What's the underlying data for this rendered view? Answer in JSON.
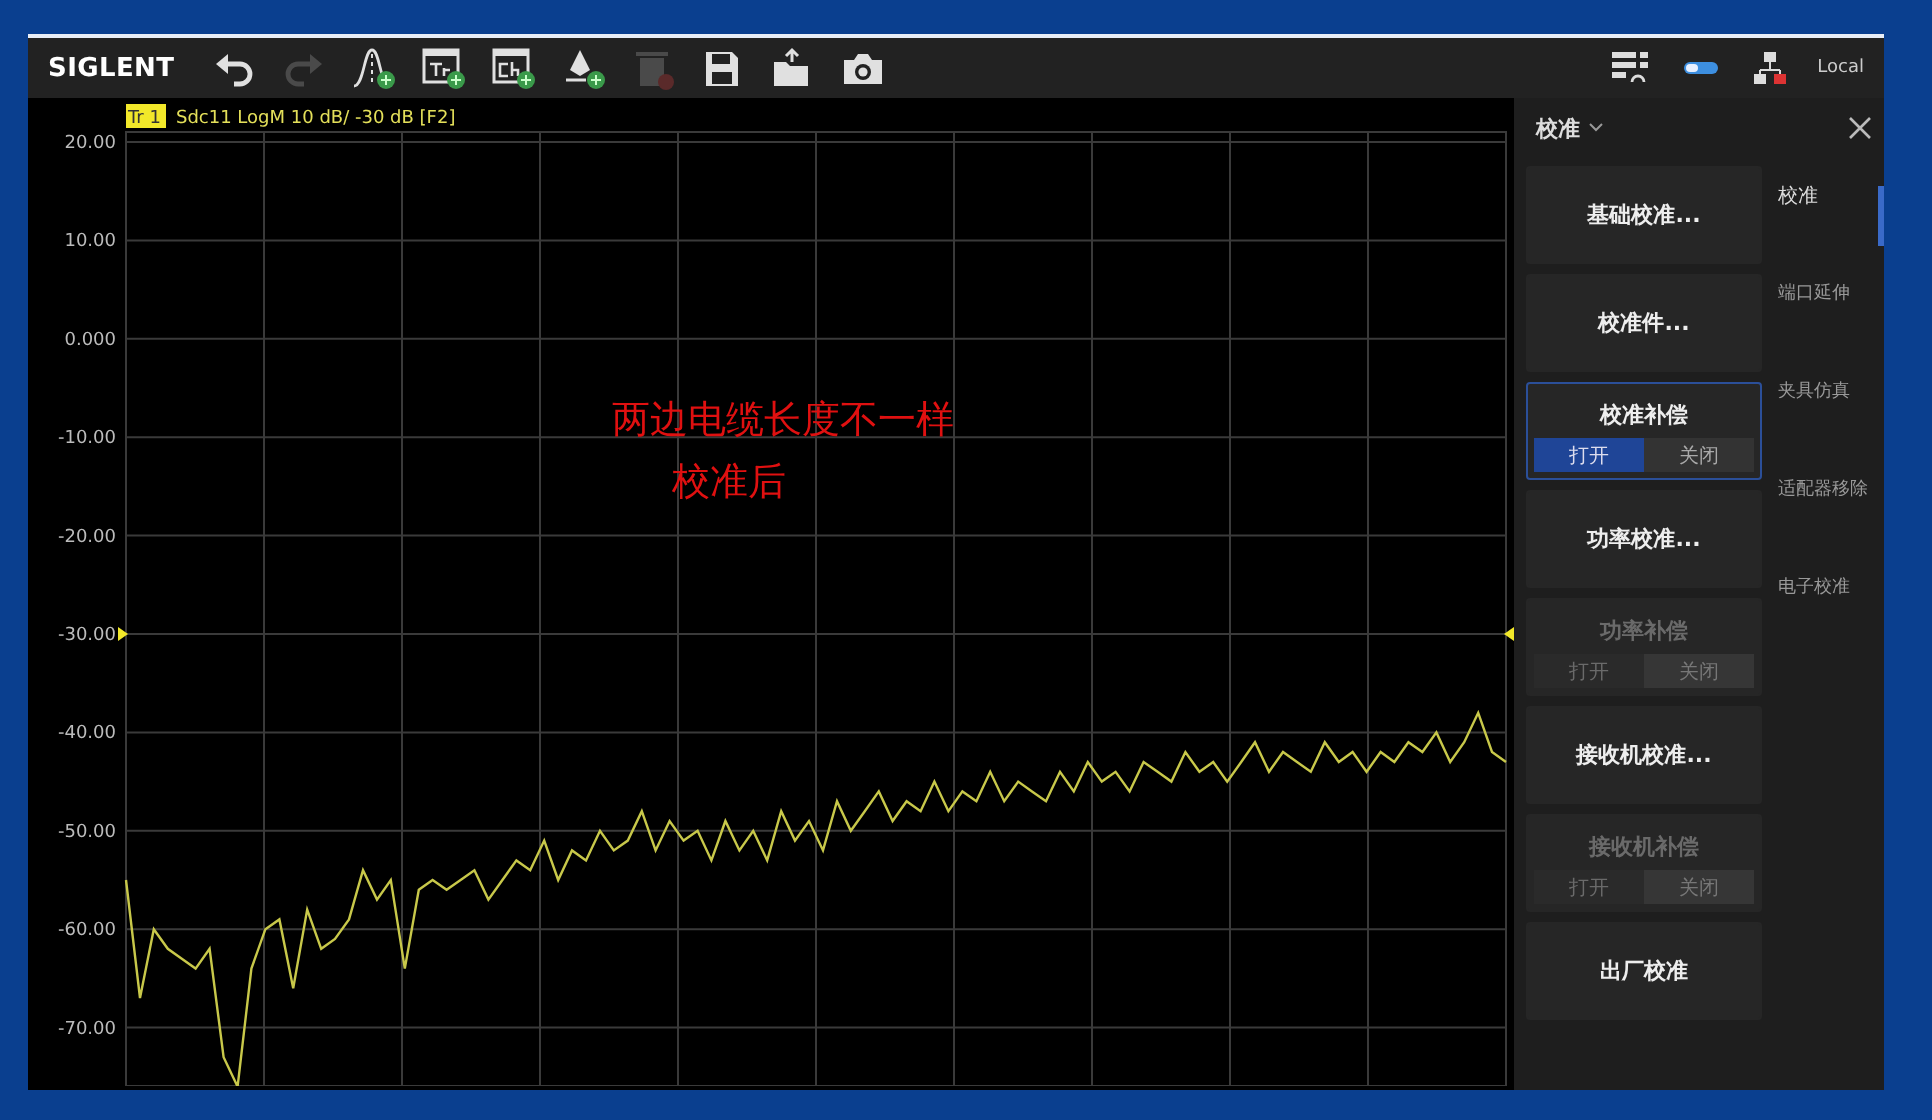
{
  "toolbar": {
    "logo": "SIGLENT",
    "tools": [
      {
        "kind": "undo",
        "disabled": false
      },
      {
        "kind": "redo",
        "disabled": true
      },
      {
        "kind": "trace-add",
        "disabled": false
      },
      {
        "kind": "tr-window-add",
        "disabled": false
      },
      {
        "kind": "ch-window-add",
        "disabled": false
      },
      {
        "kind": "marker-add",
        "disabled": false
      },
      {
        "kind": "delete",
        "disabled": true
      },
      {
        "kind": "save",
        "disabled": false
      },
      {
        "kind": "open",
        "disabled": false
      },
      {
        "kind": "camera",
        "disabled": false
      }
    ],
    "status": {
      "mode": "Local"
    }
  },
  "plot": {
    "trace_badge": "Tr 1",
    "trace_label": "Sdc11 LogM 10 dB/ -30 dB [F2]",
    "reference_markers": {
      "shown": true
    },
    "overlay_note": [
      "两边电缆长度不一样",
      "校准后"
    ],
    "chart_data": {
      "type": "line",
      "ylim": [
        -76,
        21
      ],
      "yticks": [
        {
          "value": 20,
          "label": "20.00"
        },
        {
          "value": 10,
          "label": "10.00"
        },
        {
          "value": 0,
          "label": "0.000"
        },
        {
          "value": -10,
          "label": "-10.00"
        },
        {
          "value": -20,
          "label": "-20.00"
        },
        {
          "value": -30,
          "label": "-30.00"
        },
        {
          "value": -40,
          "label": "-40.00"
        },
        {
          "value": -50,
          "label": "-50.00"
        },
        {
          "value": -60,
          "label": "-60.00"
        },
        {
          "value": -70,
          "label": "-70.00"
        }
      ],
      "grid": true,
      "series": [
        {
          "color": "#c8c84a",
          "values": [
            -55,
            -67,
            -60,
            -62,
            -63,
            -64,
            -62,
            -73,
            -76,
            -64,
            -60,
            -59,
            -66,
            -58,
            -62,
            -61,
            -59,
            -54,
            -57,
            -55,
            -64,
            -56,
            -55,
            -56,
            -55,
            -54,
            -57,
            -55,
            -53,
            -54,
            -51,
            -55,
            -52,
            -53,
            -50,
            -52,
            -51,
            -48,
            -52,
            -49,
            -51,
            -50,
            -53,
            -49,
            -52,
            -50,
            -53,
            -48,
            -51,
            -49,
            -52,
            -47,
            -50,
            -48,
            -46,
            -49,
            -47,
            -48,
            -45,
            -48,
            -46,
            -47,
            -44,
            -47,
            -45,
            -46,
            -47,
            -44,
            -46,
            -43,
            -45,
            -44,
            -46,
            -43,
            -44,
            -45,
            -42,
            -44,
            -43,
            -45,
            -43,
            -41,
            -44,
            -42,
            -43,
            -44,
            -41,
            -43,
            -42,
            -44,
            -42,
            -43,
            -41,
            -42,
            -40,
            -43,
            -41,
            -38,
            -42,
            -43
          ]
        }
      ]
    }
  },
  "panel": {
    "title": "校准",
    "cards": [
      {
        "kind": "action",
        "label": "基础校准...",
        "disabled": false
      },
      {
        "kind": "action",
        "label": "校准件...",
        "disabled": false
      },
      {
        "kind": "toggle",
        "label": "校准补偿",
        "disabled": false,
        "focused": true,
        "options": [
          {
            "label": "打开",
            "selected": true
          },
          {
            "label": "关闭",
            "selected": false
          }
        ]
      },
      {
        "kind": "action",
        "label": "功率校准...",
        "disabled": false
      },
      {
        "kind": "toggle",
        "label": "功率补偿",
        "disabled": true,
        "focused": false,
        "options": [
          {
            "label": "打开",
            "selected": false
          },
          {
            "label": "关闭",
            "selected": true
          }
        ]
      },
      {
        "kind": "action",
        "label": "接收机校准...",
        "disabled": false
      },
      {
        "kind": "toggle",
        "label": "接收机补偿",
        "disabled": true,
        "focused": false,
        "options": [
          {
            "label": "打开",
            "selected": false
          },
          {
            "label": "关闭",
            "selected": true
          }
        ]
      },
      {
        "kind": "action",
        "label": "出厂校准",
        "disabled": false
      }
    ],
    "nav": [
      {
        "label": "校准",
        "selected": true
      },
      {
        "label": "端口延伸",
        "selected": false
      },
      {
        "label": "夹具仿真",
        "selected": false
      },
      {
        "label": "适配器移除",
        "selected": false
      },
      {
        "label": "电子校准",
        "selected": false
      }
    ]
  }
}
